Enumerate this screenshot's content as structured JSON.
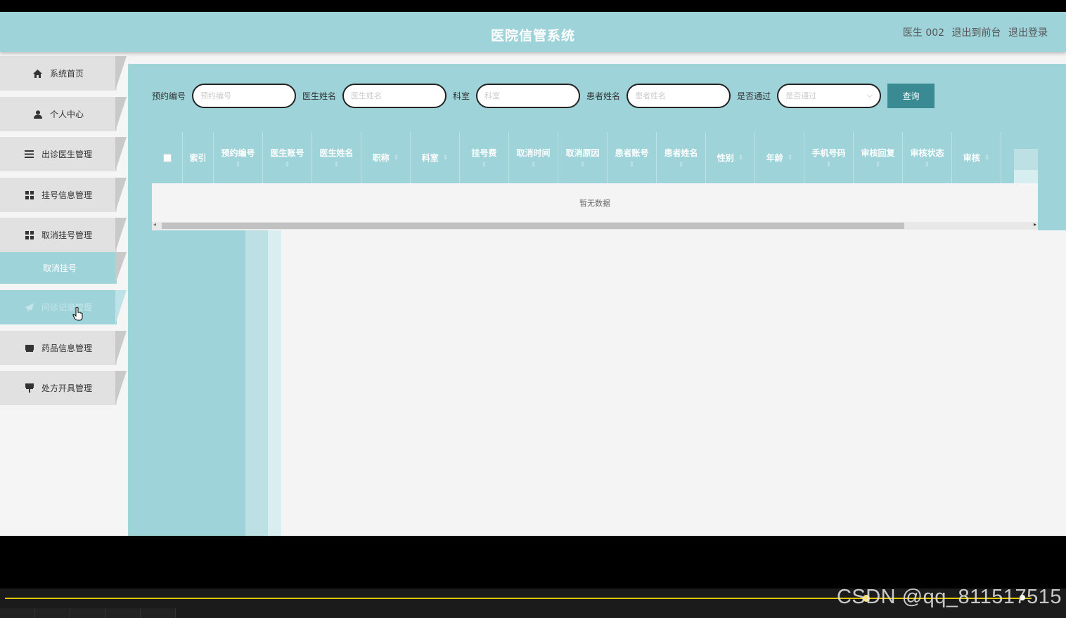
{
  "header": {
    "title": "医院信管系统",
    "user": "医生 002",
    "link_front": "退出到前台",
    "link_logout": "退出登录"
  },
  "sidebar": {
    "items": [
      {
        "label": "系统首页",
        "icon": "home-icon"
      },
      {
        "label": "个人中心",
        "icon": "user-icon"
      },
      {
        "label": "出诊医生管理",
        "icon": "list-icon"
      },
      {
        "label": "挂号信息管理",
        "icon": "grid-icon"
      },
      {
        "label": "取消挂号管理",
        "icon": "grid-icon"
      },
      {
        "label": "问诊记录管理",
        "icon": "send-icon"
      },
      {
        "label": "药品信息管理",
        "icon": "box-icon"
      },
      {
        "label": "处方开具管理",
        "icon": "stamp-icon"
      }
    ],
    "submenu_label": "取消挂号"
  },
  "search": {
    "fields": [
      {
        "label": "预约编号",
        "placeholder": "预约编号"
      },
      {
        "label": "医生姓名",
        "placeholder": "医生姓名"
      },
      {
        "label": "科室",
        "placeholder": "科室"
      },
      {
        "label": "患者姓名",
        "placeholder": "患者姓名"
      }
    ],
    "select": {
      "label": "是否通过",
      "placeholder": "是否通过"
    },
    "button_label": "查询"
  },
  "table": {
    "columns": [
      "索引",
      "预约编号",
      "医生账号",
      "医生姓名",
      "职称",
      "科室",
      "挂号费",
      "取消时间",
      "取消原因",
      "患者账号",
      "患者姓名",
      "性别",
      "年龄",
      "手机号码",
      "审核回复",
      "审核状态",
      "审核"
    ],
    "empty_text": "暂无数据"
  },
  "watermark": "CSDN @qq_811517515",
  "colors": {
    "primary": "#9ed3da",
    "button": "#3a8a94",
    "progress": "#e3c700"
  }
}
